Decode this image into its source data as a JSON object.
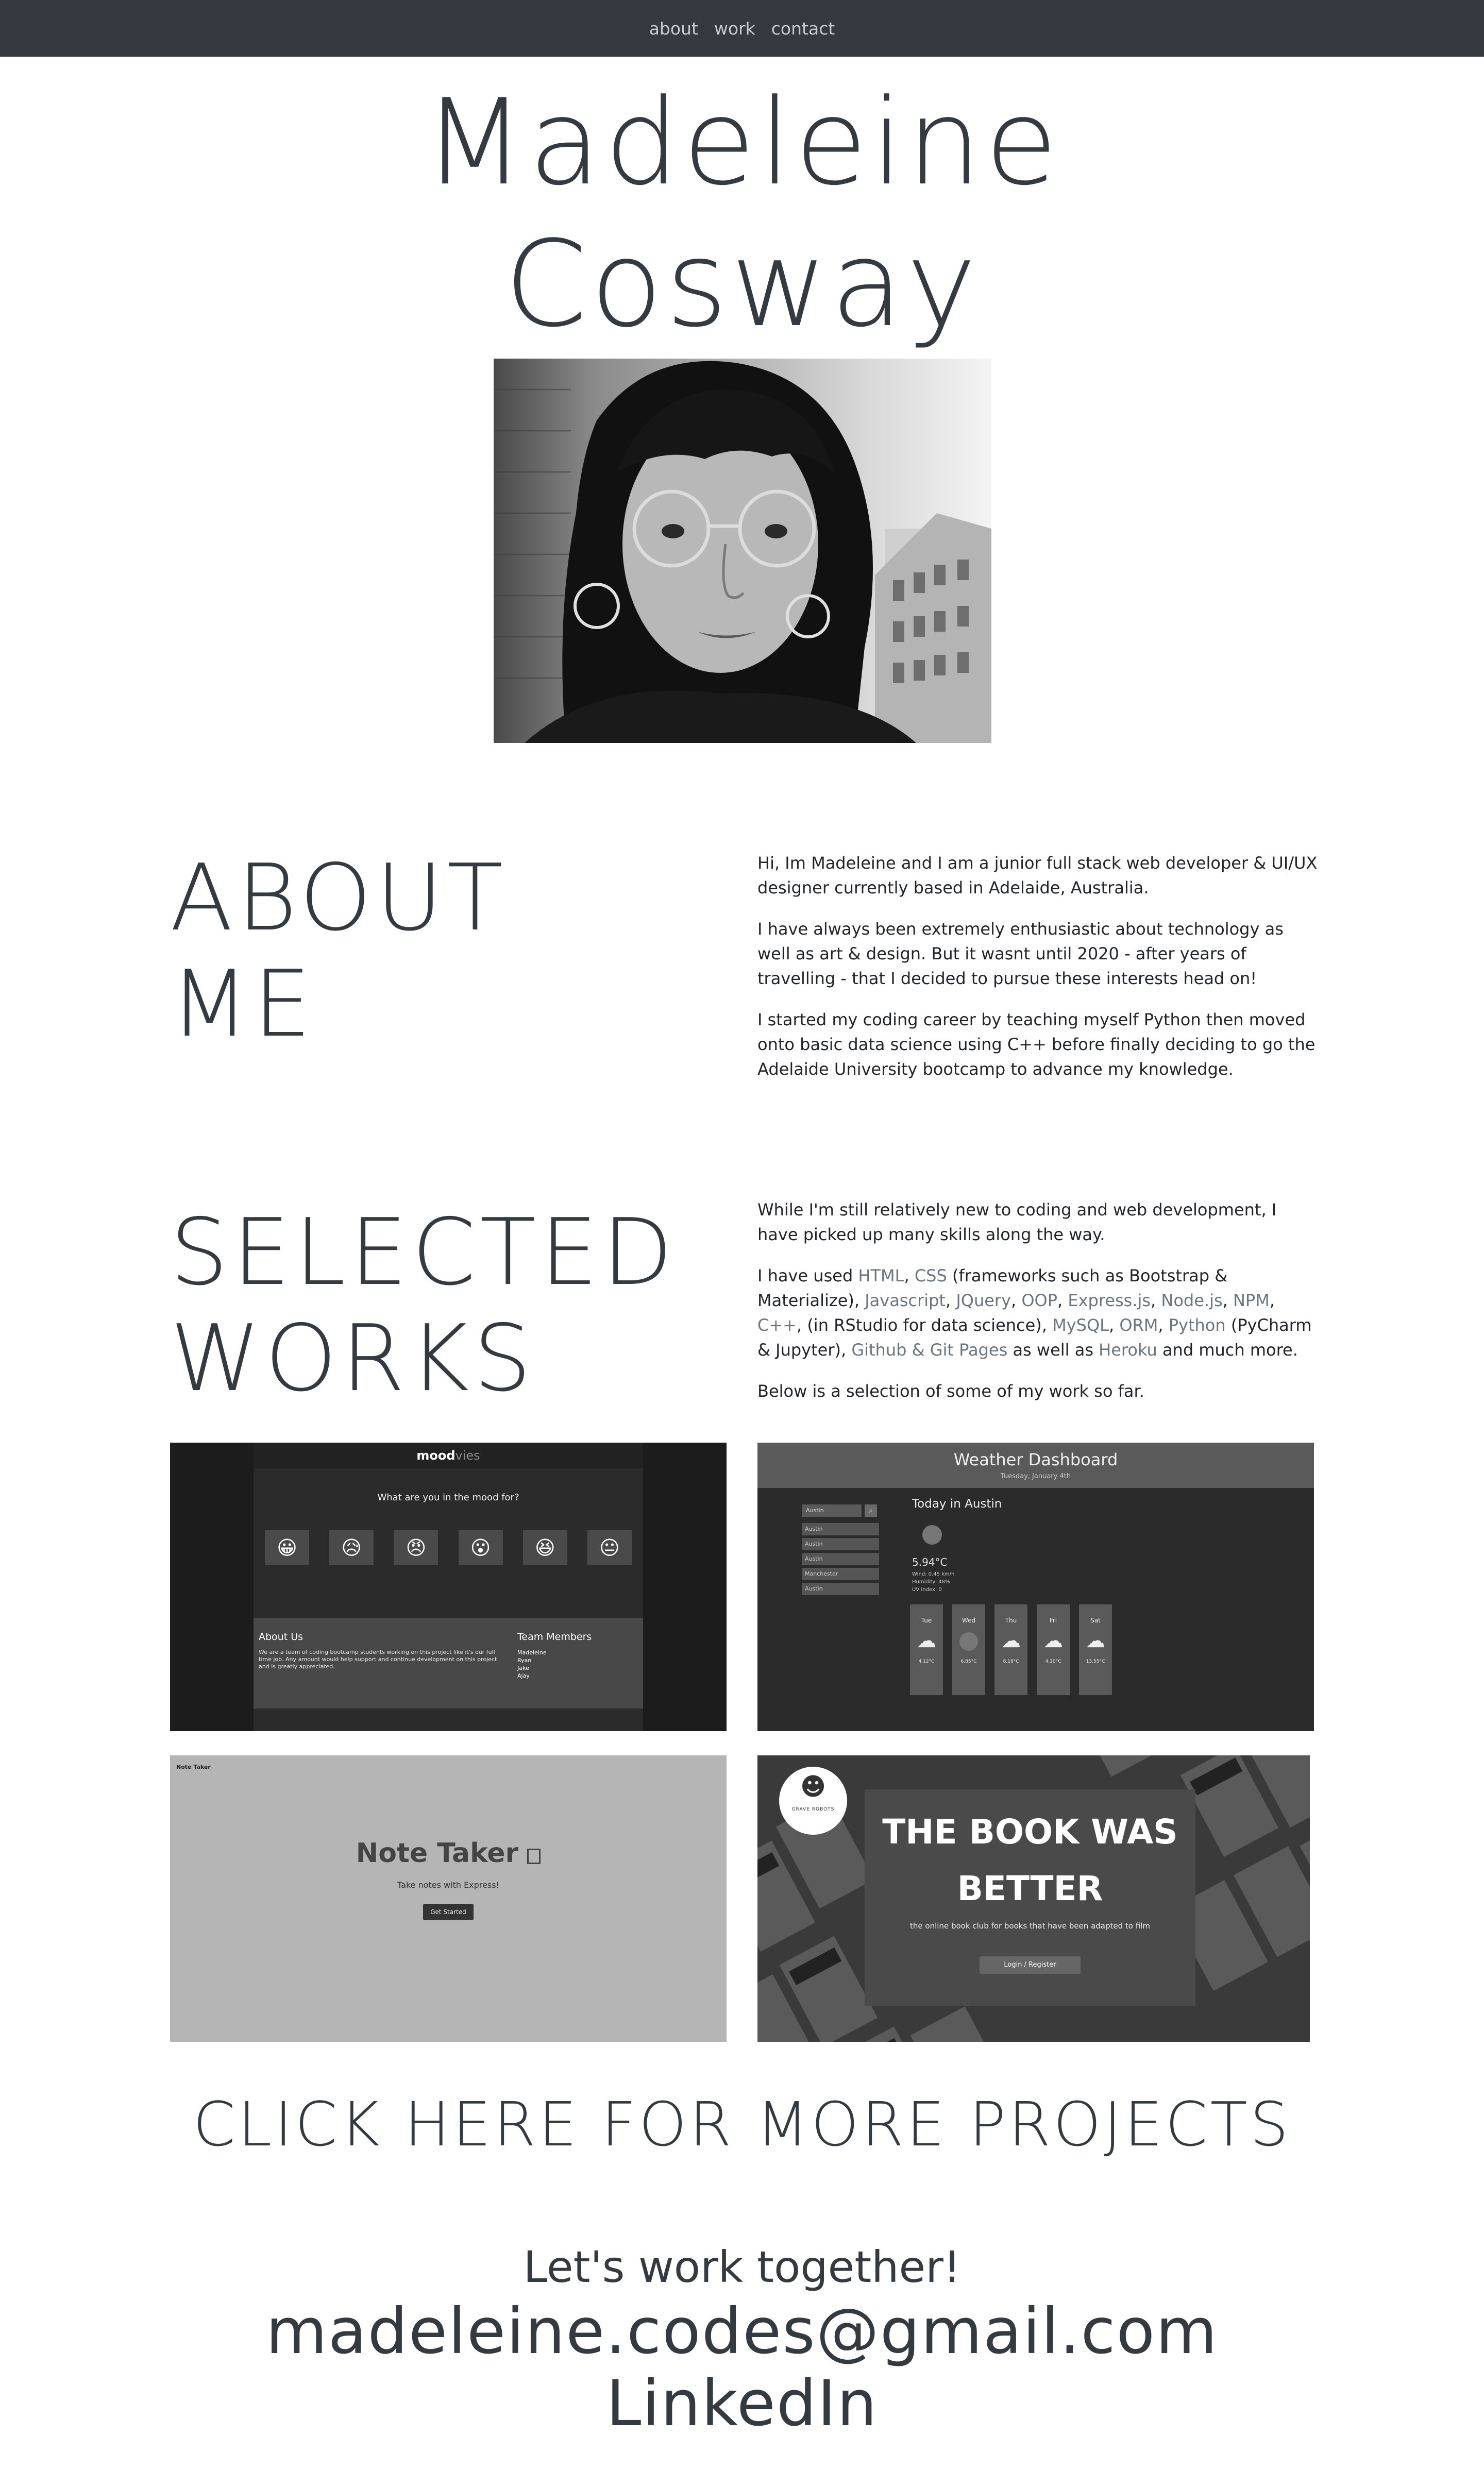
{
  "nav": {
    "items": [
      "about",
      "work",
      "contact"
    ]
  },
  "hero": {
    "name_line1": "Madeleine",
    "name_line2": "Cosway"
  },
  "about": {
    "title_line1": "ABOUT",
    "title_line2": "ME",
    "p1": "Hi, Im Madeleine and I am a junior full stack web developer & UI/UX designer currently based in Adelaide, Australia.",
    "p2": "I have always been extremely enthusiastic about technology as well as art & design. But it wasnt until 2020 - after years of travelling - that I decided to pursue these interests head on!",
    "p3": "I started my coding career by teaching myself Python then moved onto basic data science using C++ before finally deciding to go the Adelaide University bootcamp to advance my knowledge."
  },
  "works": {
    "title_line1": "SELECTED",
    "title_line2": "WORKS",
    "intro": "While I'm still relatively new to coding and web development, I have picked up many skills along the way.",
    "skills_prefix": "I have used",
    "skills": {
      "html": "HTML",
      "css": "CSS",
      "css_note": "(frameworks such as Bootstrap & Materialize),",
      "js": "Javascript",
      "jquery": "JQuery",
      "oop": "OOP",
      "express": "Express.js",
      "node": "Node.js",
      "npm": "NPM",
      "cpp": "C++",
      "cpp_note": "(in RStudio for data science),",
      "mysql": "MySQL",
      "orm": "ORM",
      "python": "Python",
      "python_note": "(PyCharm & Jupyter),",
      "github": "Github & Git Pages",
      "heroku_prefix": "as well as",
      "heroku": "Heroku",
      "end": "and much more."
    },
    "outro": "Below is a selection of some of my work so far.",
    "projects": {
      "moodvies": {
        "logo_bold": "mood",
        "logo_light": "vies",
        "question": "What are you in the mood for?",
        "emojis": [
          "😀",
          "😥",
          "😠",
          "😮",
          "😆",
          "😐"
        ],
        "about_title": "About Us",
        "about_text": "We are a team of coding bootcamp students working on this project like it's our full time job. Any amount would help support and continue development on this project and is greatly appreciated.",
        "team_title": "Team Members",
        "team": [
          "Madeleine",
          "Ryan",
          "Jake",
          "Ajay"
        ]
      },
      "weather": {
        "title": "Weather Dashboard",
        "date": "Tuesday, January 4th",
        "search": "Austin",
        "history": [
          "Austin",
          "Austin",
          "Austin",
          "Manchester",
          "Austin"
        ],
        "today": "Today in Austin",
        "temp": "5.94°C",
        "wind": "Wind: 0.45 km/h",
        "humidity": "Humidity: 48%",
        "uv": "UV Index: 0",
        "forecast": [
          {
            "day": "Tue",
            "temp": "4.12°C"
          },
          {
            "day": "Wed",
            "temp": "6.85°C"
          },
          {
            "day": "Thu",
            "temp": "8.18°C"
          },
          {
            "day": "Fri",
            "temp": "4.10°C"
          },
          {
            "day": "Sat",
            "temp": "13.55°C"
          }
        ]
      },
      "notetaker": {
        "corner": "Note Taker",
        "title": "Note Taker",
        "subtitle": "Take notes with Express!",
        "button": "Get Started"
      },
      "book": {
        "badge": "GRAVE ROBOTS",
        "title_line1": "THE BOOK WAS",
        "title_line2": "BETTER",
        "subtitle": "the online book club for books that have been adapted to film",
        "button": "Login / Register"
      }
    }
  },
  "more": "CLICK HERE FOR MORE PROJECTS",
  "contact": {
    "heading": "Let's work together!",
    "email": "madeleine.codes@gmail.com",
    "linkedin": "LinkedIn"
  }
}
